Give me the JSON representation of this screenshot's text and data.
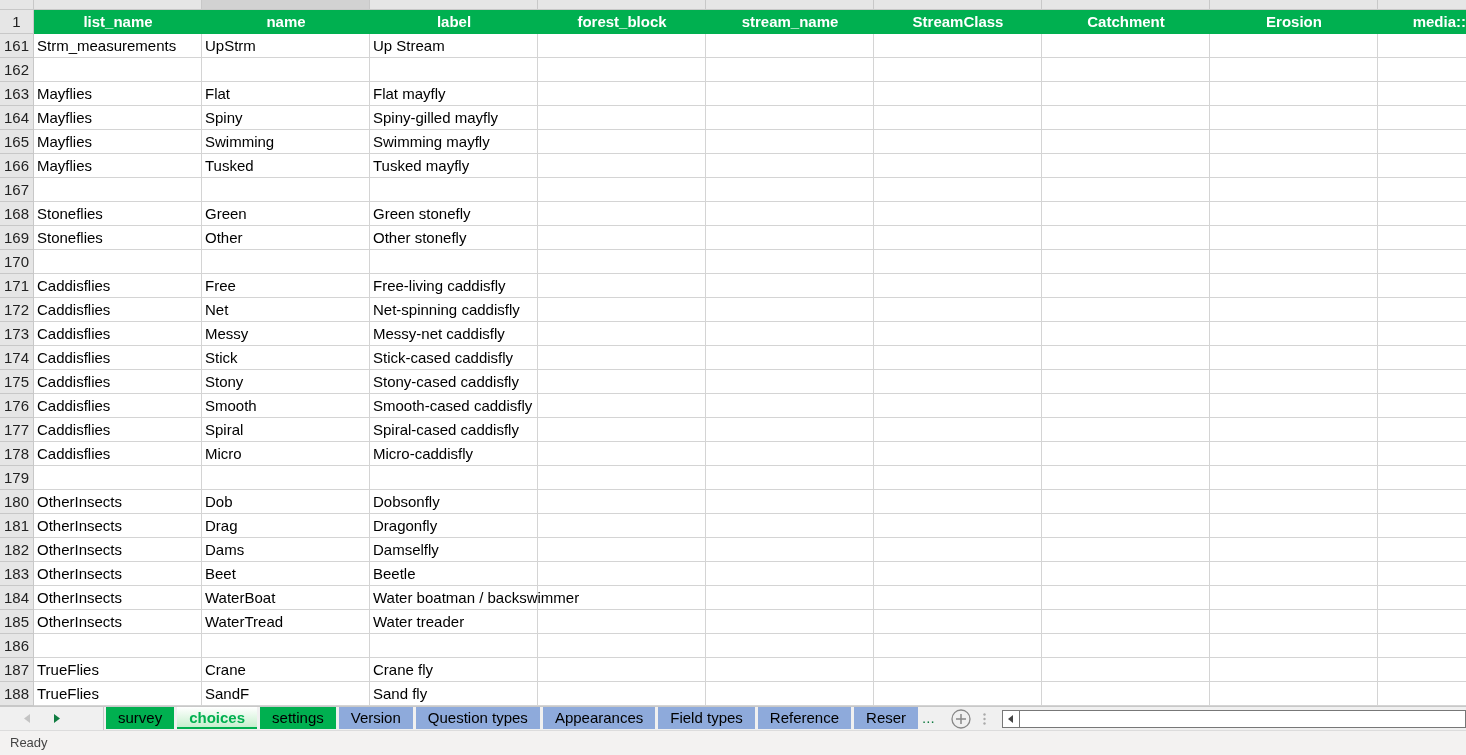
{
  "header_row": {
    "number": "1",
    "columns": [
      "list_name",
      "name",
      "label",
      "forest_block",
      "stream_name",
      "StreamClass",
      "Catchment",
      "Erosion",
      "media::"
    ]
  },
  "rows": [
    {
      "number": "161",
      "cells": [
        "Strm_measurements",
        "UpStrm",
        "Up Stream"
      ]
    },
    {
      "number": "162",
      "cells": []
    },
    {
      "number": "163",
      "cells": [
        "Mayflies",
        "Flat",
        "Flat mayfly"
      ]
    },
    {
      "number": "164",
      "cells": [
        "Mayflies",
        "Spiny",
        "Spiny-gilled mayfly"
      ]
    },
    {
      "number": "165",
      "cells": [
        "Mayflies",
        "Swimming",
        "Swimming mayfly"
      ]
    },
    {
      "number": "166",
      "cells": [
        "Mayflies",
        "Tusked",
        "Tusked mayfly"
      ]
    },
    {
      "number": "167",
      "cells": []
    },
    {
      "number": "168",
      "cells": [
        "Stoneflies",
        "Green",
        "Green stonefly"
      ]
    },
    {
      "number": "169",
      "cells": [
        "Stoneflies",
        "Other",
        "Other stonefly"
      ]
    },
    {
      "number": "170",
      "cells": []
    },
    {
      "number": "171",
      "cells": [
        "Caddisflies",
        "Free",
        "Free-living caddisfly"
      ]
    },
    {
      "number": "172",
      "cells": [
        "Caddisflies",
        "Net",
        "Net-spinning caddisfly"
      ]
    },
    {
      "number": "173",
      "cells": [
        "Caddisflies",
        "Messy",
        "Messy-net caddisfly"
      ]
    },
    {
      "number": "174",
      "cells": [
        "Caddisflies",
        "Stick",
        "Stick-cased caddisfly"
      ]
    },
    {
      "number": "175",
      "cells": [
        "Caddisflies",
        "Stony",
        "Stony-cased caddisfly"
      ]
    },
    {
      "number": "176",
      "cells": [
        "Caddisflies",
        "Smooth",
        "Smooth-cased caddisfly"
      ]
    },
    {
      "number": "177",
      "cells": [
        "Caddisflies",
        "Spiral",
        "Spiral-cased caddisfly"
      ]
    },
    {
      "number": "178",
      "cells": [
        "Caddisflies",
        "Micro",
        "Micro-caddisfly"
      ]
    },
    {
      "number": "179",
      "cells": []
    },
    {
      "number": "180",
      "cells": [
        "OtherInsects",
        "Dob",
        "Dobsonfly"
      ]
    },
    {
      "number": "181",
      "cells": [
        "OtherInsects",
        "Drag",
        "Dragonfly"
      ]
    },
    {
      "number": "182",
      "cells": [
        "OtherInsects",
        "Dams",
        "Damselfly"
      ]
    },
    {
      "number": "183",
      "cells": [
        "OtherInsects",
        "Beet",
        "Beetle"
      ]
    },
    {
      "number": "184",
      "cells": [
        "OtherInsects",
        "WaterBoat",
        "Water boatman / backswimmer"
      ]
    },
    {
      "number": "185",
      "cells": [
        "OtherInsects",
        "WaterTread",
        "Water treader"
      ]
    },
    {
      "number": "186",
      "cells": []
    },
    {
      "number": "187",
      "cells": [
        "TrueFlies",
        "Crane",
        "Crane fly"
      ]
    },
    {
      "number": "188",
      "cells": [
        "TrueFlies",
        "SandF",
        "Sand fly"
      ]
    }
  ],
  "sheet_tabs": [
    {
      "label": "survey",
      "color": "#00b050",
      "selected": false
    },
    {
      "label": "choices",
      "color": "#00b050",
      "selected": true
    },
    {
      "label": "settings",
      "color": "#00b050",
      "selected": false
    },
    {
      "label": "Version",
      "color": "#8eaadb",
      "selected": false
    },
    {
      "label": "Question types",
      "color": "#8eaadb",
      "selected": false
    },
    {
      "label": "Appearances",
      "color": "#8eaadb",
      "selected": false
    },
    {
      "label": "Field types",
      "color": "#8eaadb",
      "selected": false
    },
    {
      "label": "Reference",
      "color": "#8eaadb",
      "selected": false
    },
    {
      "label": "Reser",
      "color": "#8eaadb",
      "selected": false
    }
  ],
  "more_tabs": "...",
  "status_bar": {
    "text": "Ready"
  }
}
